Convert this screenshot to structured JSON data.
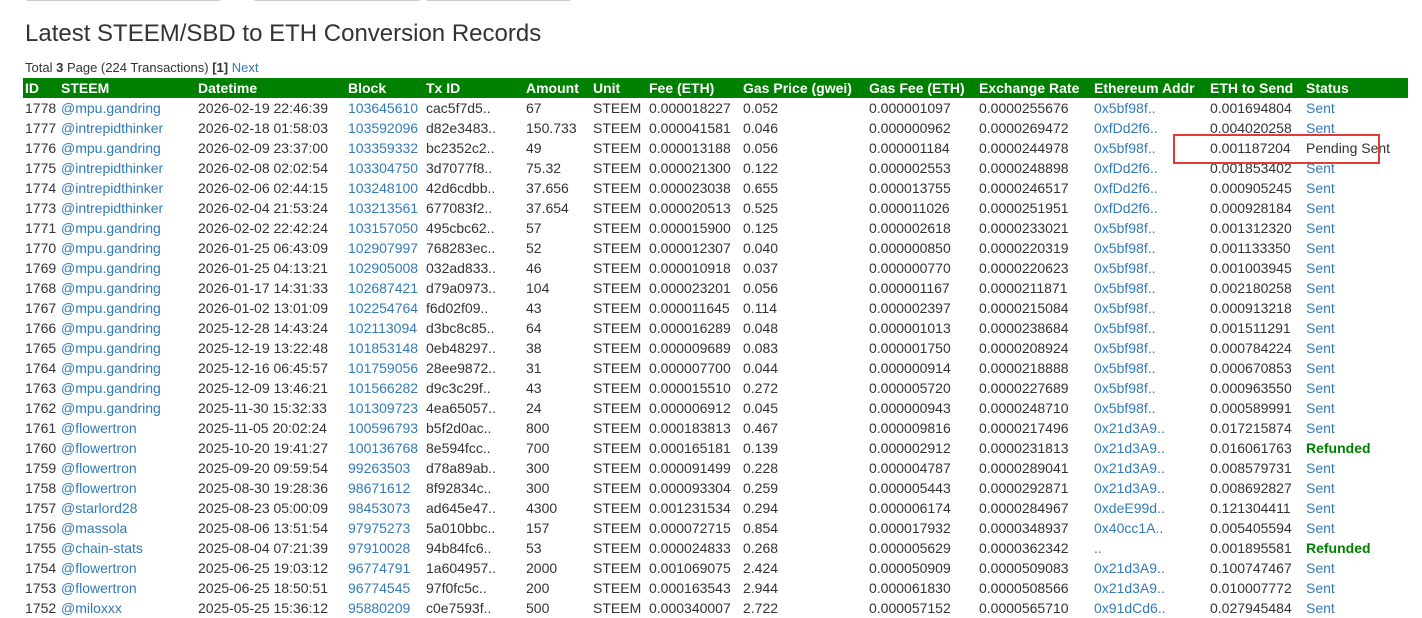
{
  "page": {
    "title": "Latest STEEM/SBD to ETH Conversion Records",
    "summary_total_label": "Total",
    "summary_total_value": "3",
    "summary_page_label": "Page (224 Transactions)",
    "summary_current_page": "[1]",
    "summary_next_link": "Next"
  },
  "table": {
    "columns": [
      "ID",
      "STEEM",
      "Datetime",
      "Block",
      "Tx ID",
      "Amount",
      "Unit",
      "Fee (ETH)",
      "Gas Price (gwei)",
      "Gas Fee (ETH)",
      "Exchange Rate",
      "Ethereum Addr",
      "ETH to Send",
      "Status"
    ],
    "rows": [
      [
        "1778",
        "@mpu.gandring",
        "2026-02-19 22:46:39",
        "103645610",
        "cac5f7d5..",
        "67",
        "STEEM",
        "0.000018227",
        "0.052",
        "0.000001097",
        "0.0000255676",
        "0x5bf98f..",
        "0.001694804",
        "Sent"
      ],
      [
        "1777",
        "@intrepidthinker",
        "2026-02-18 01:58:03",
        "103592096",
        "d82e3483..",
        "150.733",
        "STEEM",
        "0.000041581",
        "0.046",
        "0.000000962",
        "0.0000269472",
        "0xfDd2f6..",
        "0.004020258",
        "Sent"
      ],
      [
        "1776",
        "@mpu.gandring",
        "2026-02-09 23:37:00",
        "103359332",
        "bc2352c2..",
        "49",
        "STEEM",
        "0.000013188",
        "0.056",
        "0.000001184",
        "0.0000244978",
        "0x5bf98f..",
        "0.001187204",
        "Pending Sent"
      ],
      [
        "1775",
        "@intrepidthinker",
        "2026-02-08 02:02:54",
        "103304750",
        "3d7077f8..",
        "75.32",
        "STEEM",
        "0.000021300",
        "0.122",
        "0.000002553",
        "0.0000248898",
        "0xfDd2f6..",
        "0.001853402",
        "Sent"
      ],
      [
        "1774",
        "@intrepidthinker",
        "2026-02-06 02:44:15",
        "103248100",
        "42d6cdbb..",
        "37.656",
        "STEEM",
        "0.000023038",
        "0.655",
        "0.000013755",
        "0.0000246517",
        "0xfDd2f6..",
        "0.000905245",
        "Sent"
      ],
      [
        "1773",
        "@intrepidthinker",
        "2026-02-04 21:53:24",
        "103213561",
        "677083f2..",
        "37.654",
        "STEEM",
        "0.000020513",
        "0.525",
        "0.000011026",
        "0.0000251951",
        "0xfDd2f6..",
        "0.000928184",
        "Sent"
      ],
      [
        "1771",
        "@mpu.gandring",
        "2026-02-02 22:42:24",
        "103157050",
        "495cbc62..",
        "57",
        "STEEM",
        "0.000015900",
        "0.125",
        "0.000002618",
        "0.0000233021",
        "0x5bf98f..",
        "0.001312320",
        "Sent"
      ],
      [
        "1770",
        "@mpu.gandring",
        "2026-01-25 06:43:09",
        "102907997",
        "768283ec..",
        "52",
        "STEEM",
        "0.000012307",
        "0.040",
        "0.000000850",
        "0.0000220319",
        "0x5bf98f..",
        "0.001133350",
        "Sent"
      ],
      [
        "1769",
        "@mpu.gandring",
        "2026-01-25 04:13:21",
        "102905008",
        "032ad833..",
        "46",
        "STEEM",
        "0.000010918",
        "0.037",
        "0.000000770",
        "0.0000220623",
        "0x5bf98f..",
        "0.001003945",
        "Sent"
      ],
      [
        "1768",
        "@mpu.gandring",
        "2026-01-17 14:31:33",
        "102687421",
        "d79a0973..",
        "104",
        "STEEM",
        "0.000023201",
        "0.056",
        "0.000001167",
        "0.0000211871",
        "0x5bf98f..",
        "0.002180258",
        "Sent"
      ],
      [
        "1767",
        "@mpu.gandring",
        "2026-01-02 13:01:09",
        "102254764",
        "f6d02f09..",
        "43",
        "STEEM",
        "0.000011645",
        "0.114",
        "0.000002397",
        "0.0000215084",
        "0x5bf98f..",
        "0.000913218",
        "Sent"
      ],
      [
        "1766",
        "@mpu.gandring",
        "2025-12-28 14:43:24",
        "102113094",
        "d3bc8c85..",
        "64",
        "STEEM",
        "0.000016289",
        "0.048",
        "0.000001013",
        "0.0000238684",
        "0x5bf98f..",
        "0.001511291",
        "Sent"
      ],
      [
        "1765",
        "@mpu.gandring",
        "2025-12-19 13:22:48",
        "101853148",
        "0eb48297..",
        "38",
        "STEEM",
        "0.000009689",
        "0.083",
        "0.000001750",
        "0.0000208924",
        "0x5bf98f..",
        "0.000784224",
        "Sent"
      ],
      [
        "1764",
        "@mpu.gandring",
        "2025-12-16 06:45:57",
        "101759056",
        "28ee9872..",
        "31",
        "STEEM",
        "0.000007700",
        "0.044",
        "0.000000914",
        "0.0000218888",
        "0x5bf98f..",
        "0.000670853",
        "Sent"
      ],
      [
        "1763",
        "@mpu.gandring",
        "2025-12-09 13:46:21",
        "101566282",
        "d9c3c29f..",
        "43",
        "STEEM",
        "0.000015510",
        "0.272",
        "0.000005720",
        "0.0000227689",
        "0x5bf98f..",
        "0.000963550",
        "Sent"
      ],
      [
        "1762",
        "@mpu.gandring",
        "2025-11-30 15:32:33",
        "101309723",
        "4ea65057..",
        "24",
        "STEEM",
        "0.000006912",
        "0.045",
        "0.000000943",
        "0.0000248710",
        "0x5bf98f..",
        "0.000589991",
        "Sent"
      ],
      [
        "1761",
        "@flowertron",
        "2025-11-05 20:02:24",
        "100596793",
        "b5f2d0ac..",
        "800",
        "STEEM",
        "0.000183813",
        "0.467",
        "0.000009816",
        "0.0000217496",
        "0x21d3A9..",
        "0.017215874",
        "Sent"
      ],
      [
        "1760",
        "@flowertron",
        "2025-10-20 19:41:27",
        "100136768",
        "8e594fcc..",
        "700",
        "STEEM",
        "0.000165181",
        "0.139",
        "0.000002912",
        "0.0000231813",
        "0x21d3A9..",
        "0.016061763",
        "Refunded"
      ],
      [
        "1759",
        "@flowertron",
        "2025-09-20 09:59:54",
        "99263503",
        "d78a89ab..",
        "300",
        "STEEM",
        "0.000091499",
        "0.228",
        "0.000004787",
        "0.0000289041",
        "0x21d3A9..",
        "0.008579731",
        "Sent"
      ],
      [
        "1758",
        "@flowertron",
        "2025-08-30 19:28:36",
        "98671612",
        "8f92834c..",
        "300",
        "STEEM",
        "0.000093304",
        "0.259",
        "0.000005443",
        "0.0000292871",
        "0x21d3A9..",
        "0.008692827",
        "Sent"
      ],
      [
        "1757",
        "@starlord28",
        "2025-08-23 05:00:09",
        "98453073",
        "ad645e47..",
        "4300",
        "STEEM",
        "0.001231534",
        "0.294",
        "0.000006174",
        "0.0000284967",
        "0xdeE99d..",
        "0.121304411",
        "Sent"
      ],
      [
        "1756",
        "@massola",
        "2025-08-06 13:51:54",
        "97975273",
        "5a010bbc..",
        "157",
        "STEEM",
        "0.000072715",
        "0.854",
        "0.000017932",
        "0.0000348937",
        "0x40cc1A..",
        "0.005405594",
        "Sent"
      ],
      [
        "1755",
        "@chain-stats",
        "2025-08-04 07:21:39",
        "97910028",
        "94b84fc6..",
        "53",
        "STEEM",
        "0.000024833",
        "0.268",
        "0.000005629",
        "0.0000362342",
        "..",
        "0.001895581",
        "Refunded"
      ],
      [
        "1754",
        "@flowertron",
        "2025-06-25 19:03:12",
        "96774791",
        "1a604957..",
        "2000",
        "STEEM",
        "0.001069075",
        "2.424",
        "0.000050909",
        "0.0000509083",
        "0x21d3A9..",
        "0.100747467",
        "Sent"
      ],
      [
        "1753",
        "@flowertron",
        "2025-06-25 18:50:51",
        "96774545",
        "97f0fc5c..",
        "200",
        "STEEM",
        "0.000163543",
        "2.944",
        "0.000061830",
        "0.0000508566",
        "0x21d3A9..",
        "0.010007772",
        "Sent"
      ],
      [
        "1752",
        "@miloxxx",
        "2025-05-25 15:36:12",
        "95880209",
        "c0e7593f..",
        "500",
        "STEEM",
        "0.000340007",
        "2.722",
        "0.000057152",
        "0.0000565710",
        "0x91dCd6..",
        "0.027945484",
        "Sent"
      ]
    ]
  },
  "colors": {
    "header_bg": "#008000",
    "link": "#337ab7",
    "refunded": "#008000",
    "highlight": "#e53935"
  }
}
